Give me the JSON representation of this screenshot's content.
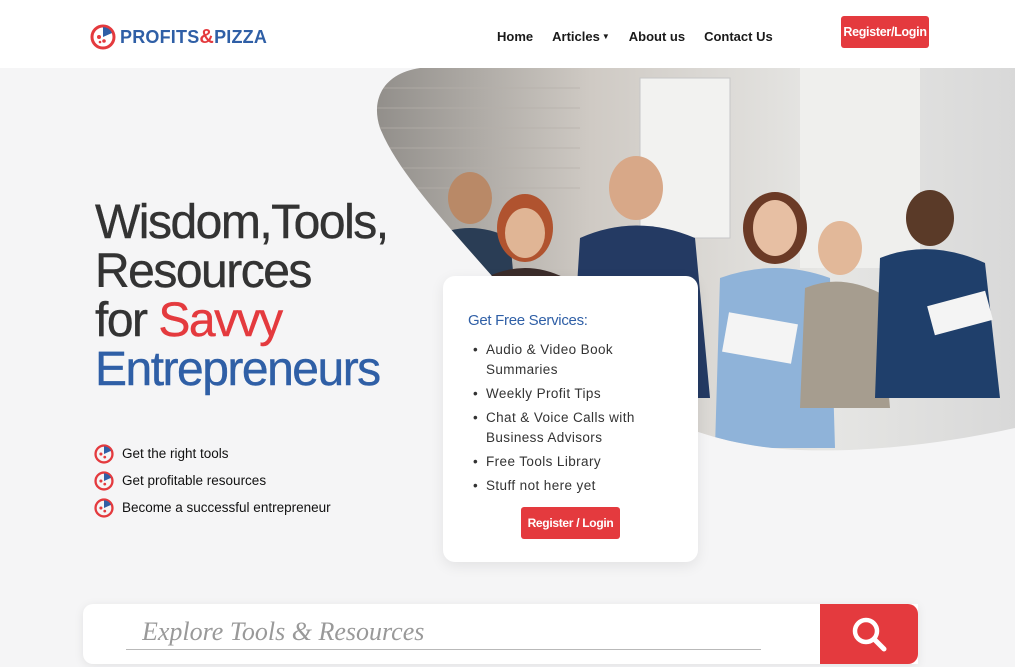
{
  "brand": {
    "name_part1": "PROFITS",
    "name_amp": "&",
    "name_part2": "PIZZA",
    "colors": {
      "red": "#e43a3e",
      "blue": "#2f5fa6"
    },
    "icon": "pizza-logo-icon"
  },
  "nav": {
    "items": [
      {
        "label": "Home"
      },
      {
        "label": "Articles",
        "icon": "caret-down-icon"
      },
      {
        "label": "About us"
      },
      {
        "label": "Contact Us"
      }
    ],
    "register_label": "Register/Login"
  },
  "hero": {
    "line1": "Wisdom,Tools,",
    "line2": "Resources",
    "line3_prefix": "for ",
    "line3_highlight": "Savvy",
    "line4": "Entrepreneurs",
    "photo": "team-of-business-people-photo"
  },
  "features": [
    {
      "label": "Get the right tools",
      "icon": "pizza-logo-icon"
    },
    {
      "label": "Get profitable resources",
      "icon": "pizza-logo-icon"
    },
    {
      "label": "Become a successful entrepreneur",
      "icon": "pizza-logo-icon"
    }
  ],
  "services": {
    "title": "Get Free Services:",
    "items": [
      {
        "line1": "Audio & Video Book",
        "line2": "Summaries"
      },
      {
        "line1": "Weekly Profit Tips",
        "line2": ""
      },
      {
        "line1": "Chat & Voice Calls with",
        "line2": "Business Advisors"
      },
      {
        "line1": "Free Tools Library",
        "line2": ""
      },
      {
        "line1": "Stuff not here yet",
        "line2": ""
      }
    ],
    "button_label": "Register / Login"
  },
  "search": {
    "placeholder": "Explore Tools & Resources",
    "icon": "search-icon"
  }
}
